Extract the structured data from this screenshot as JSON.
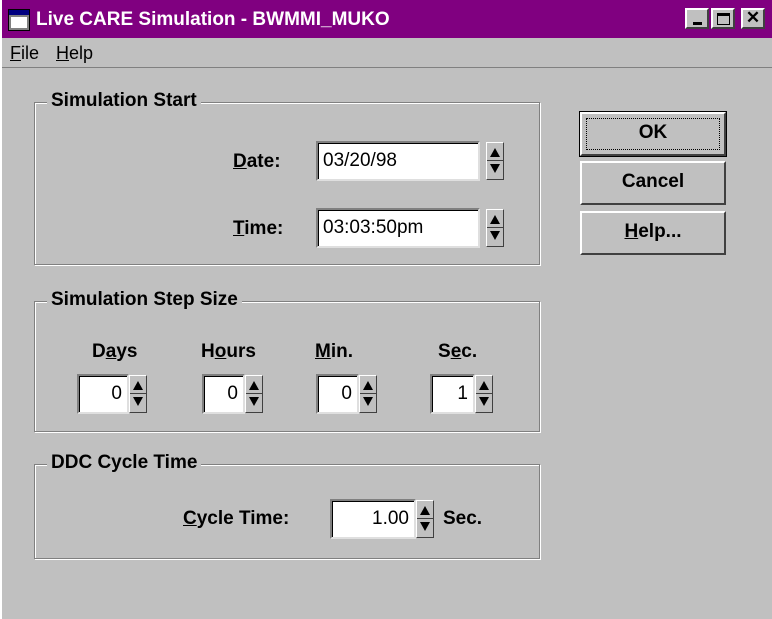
{
  "window": {
    "title": "Live CARE Simulation - BWMMI_MUKO"
  },
  "menu": {
    "file": "File",
    "help": "Help"
  },
  "simulation_start": {
    "title": "Simulation Start",
    "date_label": "Date:",
    "date_value": "03/20/98",
    "time_label": "Time:",
    "time_value": "03:03:50pm"
  },
  "step_size": {
    "title": "Simulation Step Size",
    "days_label": "Days",
    "days_value": "0",
    "hours_label": "Hours",
    "hours_value": "0",
    "min_label": "Min.",
    "min_value": "0",
    "sec_label": "Sec.",
    "sec_value": "1"
  },
  "ddc": {
    "title": "DDC Cycle Time",
    "cycle_label": "Cycle Time:",
    "cycle_value": "1.00",
    "cycle_unit": "Sec."
  },
  "buttons": {
    "ok": "OK",
    "cancel": "Cancel",
    "help": "Help..."
  },
  "colors": {
    "titlebar": "#800080",
    "face": "#c0c0c0"
  }
}
